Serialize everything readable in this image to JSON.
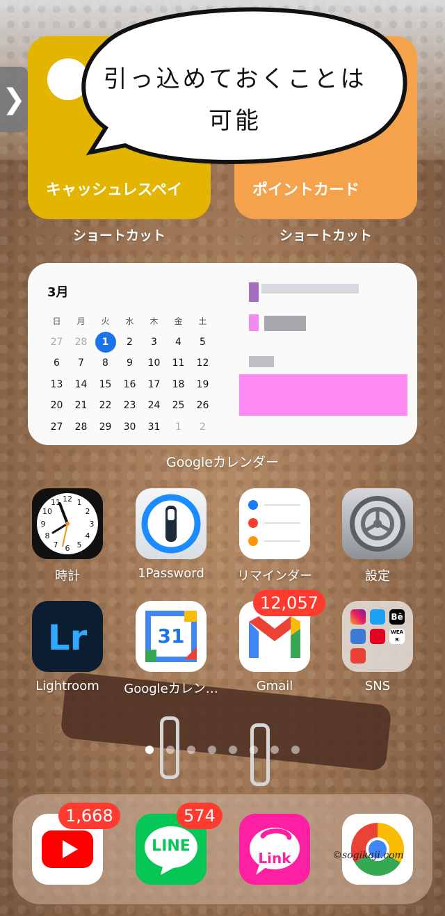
{
  "callout": {
    "line1": "引っ込めておくことは",
    "line2": "可能"
  },
  "edge_tab": {
    "glyph": "❯"
  },
  "widgets": {
    "cashless": {
      "title": "キャッシュレスペイ",
      "caption": "ショートカット",
      "color": "#e3b400"
    },
    "pointcard": {
      "title": "ポイントカード",
      "caption": "ショートカット",
      "color": "#f4a24c"
    }
  },
  "calendar": {
    "month": "3月",
    "weekdays": [
      "日",
      "月",
      "火",
      "水",
      "木",
      "金",
      "土"
    ],
    "weeks": [
      [
        "27",
        "28",
        "1",
        "2",
        "3",
        "4",
        "5"
      ],
      [
        "6",
        "7",
        "8",
        "9",
        "10",
        "11",
        "12"
      ],
      [
        "13",
        "14",
        "15",
        "16",
        "17",
        "18",
        "19"
      ],
      [
        "20",
        "21",
        "22",
        "23",
        "24",
        "25",
        "26"
      ],
      [
        "27",
        "28",
        "29",
        "30",
        "31",
        "1",
        "2"
      ]
    ],
    "today": "1",
    "caption": "Googleカレンダー"
  },
  "apps_row1": [
    {
      "label": "時計",
      "icon": "clock-icon"
    },
    {
      "label": "1Password",
      "icon": "1password-icon"
    },
    {
      "label": "リマインダー",
      "icon": "reminders-icon"
    },
    {
      "label": "設定",
      "icon": "settings-icon"
    }
  ],
  "apps_row2": [
    {
      "label": "Lightroom",
      "icon": "lightroom-icon",
      "text": "Lr"
    },
    {
      "label": "Googleカレン…",
      "icon": "google-calendar-icon",
      "text": "31"
    },
    {
      "label": "Gmail",
      "icon": "gmail-icon",
      "badge": "12,057"
    },
    {
      "label": "SNS",
      "icon": "folder-icon"
    }
  ],
  "folder_tiles": {
    "behance": "Bē",
    "wear": "WEAR"
  },
  "page_dots": {
    "count": 8,
    "active": 0
  },
  "dock": [
    {
      "name": "YouTube",
      "icon": "youtube-icon",
      "badge": "1,668"
    },
    {
      "name": "LINE",
      "icon": "line-icon",
      "badge": "574",
      "text": "LINE"
    },
    {
      "name": "Link",
      "icon": "link-icon",
      "text": "Link"
    },
    {
      "name": "Chrome",
      "icon": "chrome-icon"
    }
  ],
  "watermark": "©sogikaji.com"
}
